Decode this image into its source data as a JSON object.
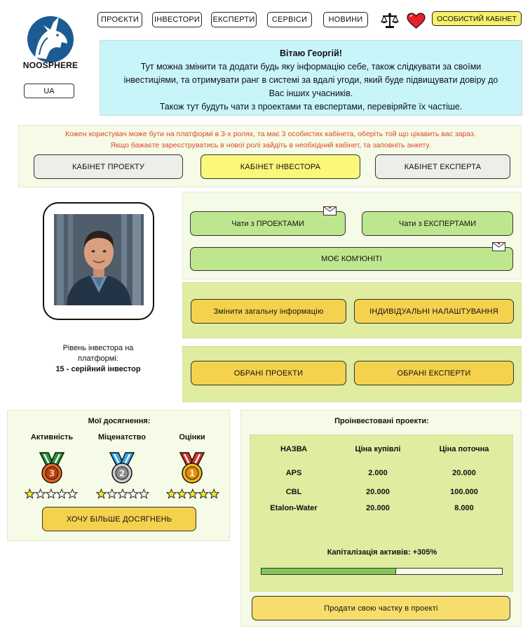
{
  "brand": {
    "name": "NOOSPHERE",
    "language": "UA"
  },
  "nav": {
    "items": [
      "ПРОЄКТИ",
      "ІНВЕСТОРИ",
      "ЕКСПЕРТИ",
      "СЕРВІСИ",
      "НОВИНИ"
    ],
    "icons": [
      "scales-icon",
      "heart-icon"
    ],
    "cabinet_label": "ОСОБИСТИЙ КАБІНЕТ"
  },
  "welcome": {
    "greeting": "Вітаю Георгій!",
    "line1": "Тут можна змінити та додати будь яку інформацію себе, також слідкувати за своїми",
    "line2": "інвестиціями, та отримувати ранг в системі за вдалі угоди, який буде підвищувати довіру до",
    "line3": "Вас інших учасників.",
    "line4": "Також тут будуть чати з проектами та евспертами, перевіряйте їх частіше."
  },
  "roles": {
    "note_line1": "Кожен користувач може бути на платформі в 3-х ролях, та має 3 особистих кабінета, оберіть той що цікавить вас зараз.",
    "note_line2": "Якщо бажаєте зареєструватись в нової ролі зайдіть в необхідний кабінет, та заповніть анкету.",
    "buttons": [
      "КАБІНЕТ ПРОЕКТУ",
      "КАБІНЕТ ІНВЕСТОРА",
      "КАБІНЕТ ЕКСПЕРТА"
    ],
    "colors": {
      "inactive": "#eceeea",
      "active": "#fbf77a"
    }
  },
  "profile": {
    "level_label": "Рівень інвестора на платформі:",
    "level_value": "15 - серійний інвестор"
  },
  "chats": {
    "projects": "Чати з ПРОЕКТАМИ",
    "experts": "Чати з ЕКСПЕРТАМИ",
    "community": "МОЄ КОМ'ЮНІТІ"
  },
  "settings": {
    "change_info": "Змінити загальну інформацію",
    "individual": "ІНДИВІДУАЛЬНІ НАЛАШТУВАННЯ"
  },
  "favorites": {
    "projects": "ОБРАНІ ПРОЕКТИ",
    "experts": "ОБРАНІ ЕКСПЕРТИ"
  },
  "achievements": {
    "title": "Мої досягнення:",
    "items": [
      {
        "label": "Активність",
        "medal": "3",
        "filled_stars": 1,
        "total_stars": 5,
        "color": "#e2621f"
      },
      {
        "label": "Міценатство",
        "medal": "2",
        "filled_stars": 1,
        "total_stars": 5,
        "color": "#a7a7a7"
      },
      {
        "label": "Оцінки",
        "medal": "1",
        "filled_stars": 5,
        "total_stars": 5,
        "color": "#f2b21b"
      }
    ],
    "more_label": "ХОЧУ БІЛЬШЕ ДОСЯГНЕНЬ"
  },
  "invested": {
    "title": "Проінвестовані проекти:",
    "headers": [
      "НАЗВА",
      "Ціна купівлі",
      "Ціна поточна"
    ],
    "rows": [
      [
        "APS",
        "2.000",
        "20.000"
      ],
      [
        "CBL",
        "20.000",
        "100.000"
      ],
      [
        "Etalon-Water",
        "20.000",
        "8.000"
      ]
    ],
    "capitalization": "Капіталізація активів: +305%",
    "progress": 0.56,
    "sell_label": "Продати свою частку в проекті"
  }
}
